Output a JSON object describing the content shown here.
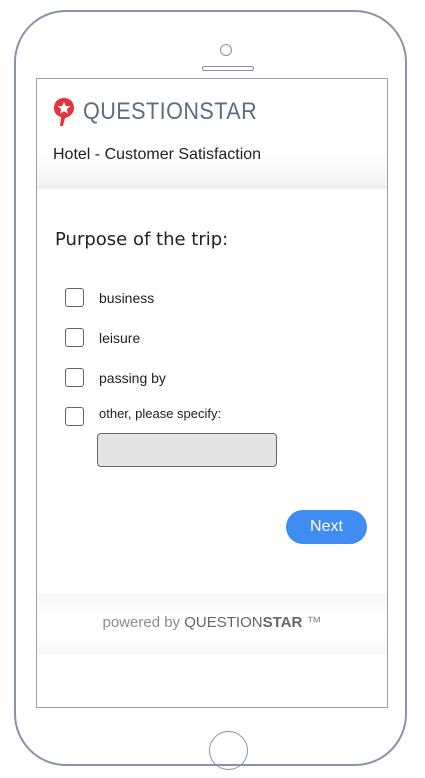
{
  "brand": {
    "name": "QUESTIONSTAR",
    "logo_color": "#e5323b"
  },
  "survey": {
    "title": "Hotel - Customer Satisfaction"
  },
  "question": {
    "title": "Purpose of the trip:",
    "options": [
      {
        "label": "business",
        "checked": false
      },
      {
        "label": "leisure",
        "checked": false
      },
      {
        "label": "passing by",
        "checked": false
      },
      {
        "label": "other, please specify:",
        "checked": false
      }
    ],
    "other_input_value": ""
  },
  "actions": {
    "next_label": "Next",
    "next_color": "#3f8cf3"
  },
  "footer": {
    "powered_by": "powered by",
    "brand_part1": "QUESTION",
    "brand_part2": "STAR",
    "trademark": "™"
  }
}
